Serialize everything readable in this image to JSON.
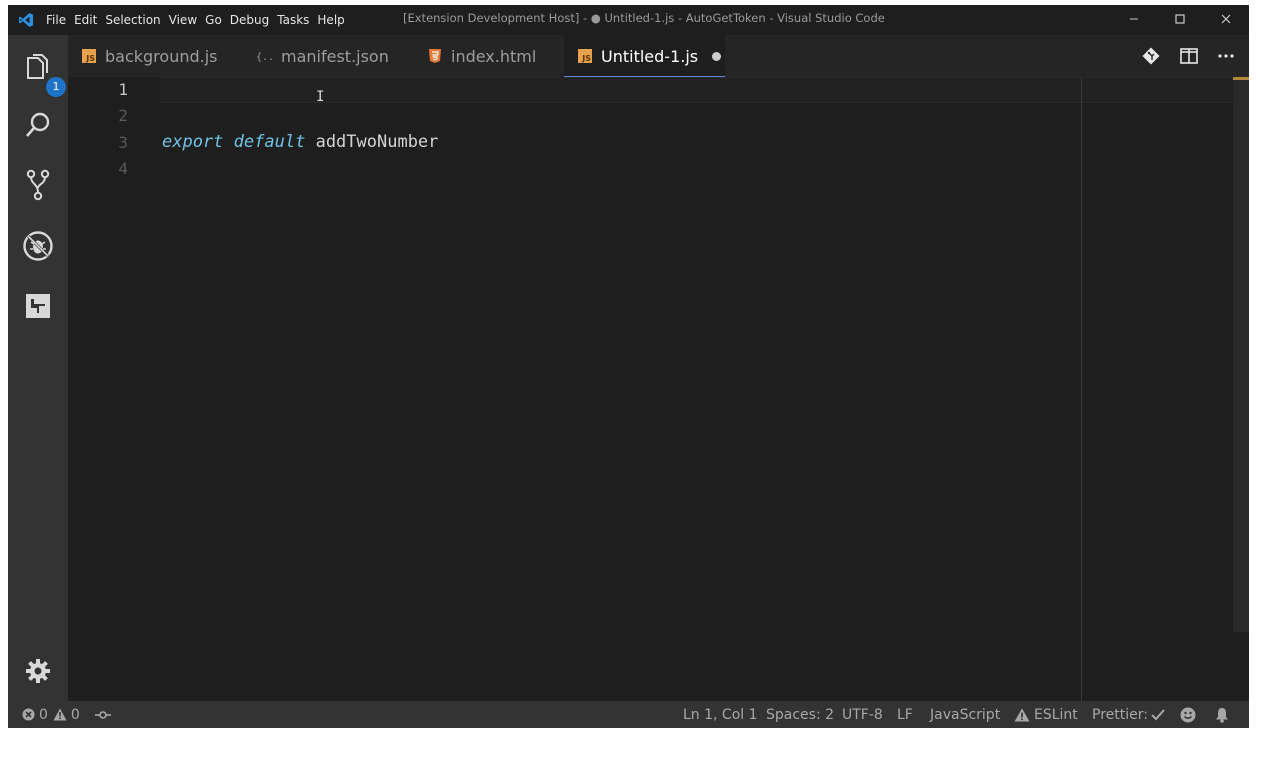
{
  "menubar": {
    "items": [
      "File",
      "Edit",
      "Selection",
      "View",
      "Go",
      "Debug",
      "Tasks",
      "Help"
    ]
  },
  "window": {
    "title": "[Extension Development Host] - ● Untitled-1.js - AutoGetToken - Visual Studio Code"
  },
  "activitybar": {
    "explorer_badge": "1",
    "icons": [
      "files-icon",
      "search-icon",
      "source-control-icon",
      "debug-icon",
      "extensions-icon",
      "gear-icon"
    ]
  },
  "tabs": [
    {
      "label": "background.js",
      "icon": "js-file-icon"
    },
    {
      "label": "manifest.json",
      "icon": "json-file-icon"
    },
    {
      "label": "index.html",
      "icon": "html5-file-icon"
    },
    {
      "label": "Untitled-1.js",
      "icon": "js-file-icon",
      "active": true,
      "dirty": true
    }
  ],
  "editor": {
    "line_numbers": [
      "1",
      "2",
      "3",
      "4"
    ],
    "current_line": 1,
    "code": {
      "line3_kw1": "export",
      "line3_kw2": "default",
      "line3_ident": "addTwoNumber"
    }
  },
  "statusbar": {
    "errors": "0",
    "warnings": "0",
    "position": "Ln 1, Col 1",
    "spaces": "Spaces: 2",
    "encoding": "UTF-8",
    "eol": "LF",
    "language": "JavaScript",
    "eslint": "ESLint",
    "prettier": "Prettier:"
  },
  "colors": {
    "accent": "#1e74c9",
    "keyword": "#6fc3e6",
    "js_icon": "#e8a24b",
    "html_icon": "#e37933"
  }
}
